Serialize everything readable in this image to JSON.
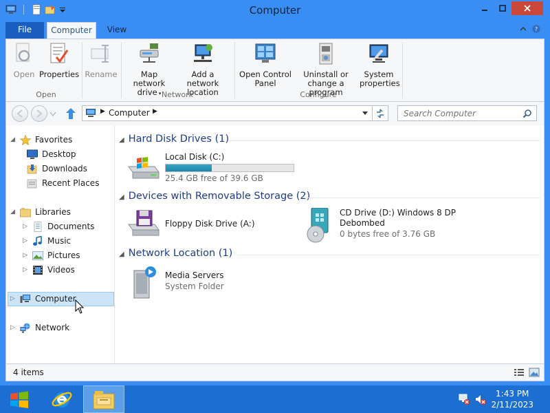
{
  "window": {
    "title": "Computer"
  },
  "tabs": {
    "file": "File",
    "computer": "Computer",
    "view": "View"
  },
  "ribbon": {
    "open": "Open",
    "properties": "Properties",
    "rename": "Rename",
    "map_network_drive_1": "Map network",
    "map_network_drive_2": "drive",
    "add_network_location_1": "Add a network",
    "add_network_location_2": "location",
    "open_control_panel_1": "Open Control",
    "open_control_panel_2": "Panel",
    "uninstall_1": "Uninstall or",
    "uninstall_2": "change a program",
    "system_properties_1": "System",
    "system_properties_2": "properties",
    "group_open": "Open",
    "group_network": "Network",
    "group_configure": "Configure"
  },
  "address": {
    "path": "Computer",
    "search_placeholder": "Search Computer"
  },
  "nav": {
    "favorites": "Favorites",
    "desktop": "Desktop",
    "downloads": "Downloads",
    "recent_places": "Recent Places",
    "libraries": "Libraries",
    "documents": "Documents",
    "music": "Music",
    "pictures": "Pictures",
    "videos": "Videos",
    "computer": "Computer",
    "network": "Network"
  },
  "groups": {
    "hard_disk": "Hard Disk Drives (1)",
    "removable": "Devices with Removable Storage (2)",
    "network_location": "Network Location (1)"
  },
  "drives": {
    "local_disk": {
      "name": "Local Disk (C:)",
      "free": "25.4 GB free of 39.6 GB",
      "used_fraction": 0.36
    },
    "floppy": {
      "name": "Floppy Disk Drive (A:)"
    },
    "cd": {
      "name_1": "CD Drive (D:) Windows 8 DP",
      "name_2": "Debombed",
      "free": "0 bytes free of 3.76 GB"
    },
    "media_servers": {
      "name": "Media Servers",
      "type": "System Folder"
    }
  },
  "status": {
    "count": "4 items"
  },
  "taskbar": {
    "time": "1:43 PM",
    "date": "2/11/2023"
  },
  "colors": {
    "accent": "#3a8df2",
    "taskbar": "#1c6fd1",
    "group_header": "#1f3c87",
    "selection": "#cce4f7",
    "progress": "#26a0c8",
    "close": "#c9483b"
  }
}
